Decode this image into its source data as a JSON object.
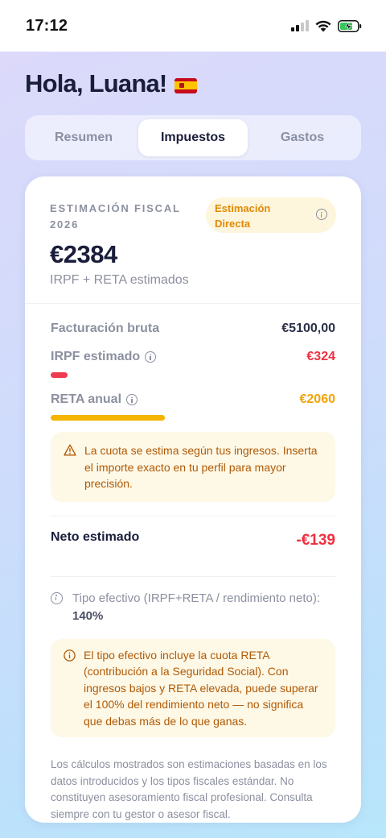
{
  "status": {
    "time": "17:12"
  },
  "greeting": "Hola, Luana!",
  "tabs": [
    {
      "label": "Resumen",
      "active": false
    },
    {
      "label": "Impuestos",
      "active": true
    },
    {
      "label": "Gastos",
      "active": false
    }
  ],
  "card": {
    "title": "ESTIMACIÓN FISCAL 2026",
    "badge": "Estimación Directa",
    "total": "€2384",
    "total_sub": "IRPF + RETA estimados",
    "rows": {
      "facturacion": {
        "label": "Facturación bruta",
        "value": "€5100,00"
      },
      "irpf": {
        "label": "IRPF estimado",
        "value": "€324",
        "color": "#ef2f3f",
        "bar_fraction": 0.06
      },
      "reta": {
        "label": "RETA anual",
        "value": "€2060",
        "color": "#f2a400",
        "bar_fraction": 0.4
      }
    },
    "warning": "La cuota se estima según tus ingresos. Inserta el importe exacto en tu perfil para mayor precisión.",
    "neto": {
      "label": "Neto estimado",
      "value": "-€139"
    },
    "tipo": {
      "label": "Tipo efectivo (IRPF+RETA / rendimiento neto):",
      "value": "140%"
    },
    "tipo_note": "El tipo efectivo incluye la cuota RETA (contribución a la Seguridad Social). Con ingresos bajos y RETA elevada, puede superar el 100% del rendimiento neto — no significa que debas más de lo que ganas.",
    "disclaimer": "Los cálculos mostrados son estimaciones basadas en los datos introducidos y los tipos fiscales estándar. No constituyen asesoramiento fiscal profesional. Consulta siempre con tu gestor o asesor fiscal."
  },
  "colors": {
    "accent_red": "#ef2f3f",
    "accent_orange": "#f2a400",
    "warning_text": "#b05a06",
    "warning_bg": "#fef8e6"
  },
  "icons": [
    "signal-icon",
    "wifi-icon",
    "battery-charging-icon",
    "spain-flag-icon",
    "info-icon",
    "warning-icon"
  ]
}
